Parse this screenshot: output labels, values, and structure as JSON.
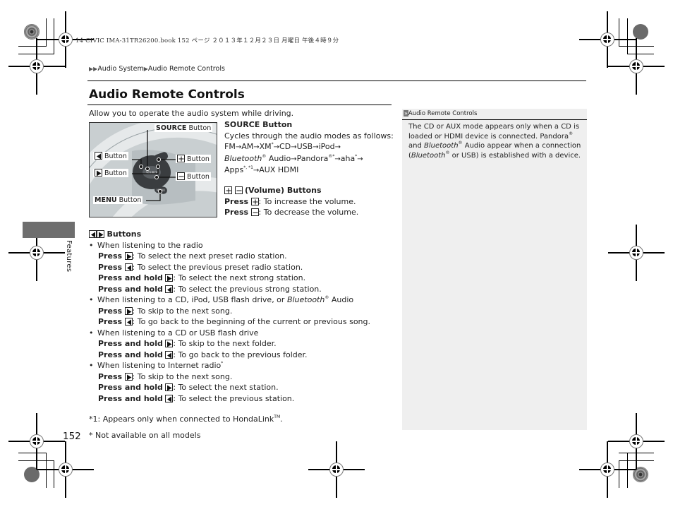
{
  "print_header": "14 CIVIC IMA-31TR26200.book  152 ページ  ２０１３年１２月２３日  月曜日  午後４時９分",
  "breadcrumb": {
    "prefix_icon": "double-triangle-icon",
    "items": [
      "Audio System",
      "Audio Remote Controls"
    ]
  },
  "page_title": "Audio Remote Controls",
  "intro": "Allow you to operate the audio system while driving.",
  "figure": {
    "labels": {
      "source": {
        "bold": "SOURCE",
        "rest": " Button"
      },
      "prev": "Button",
      "next": "Button",
      "plus": "Button",
      "minus": "Button",
      "menu": {
        "bold": "MENU",
        "rest": " Button"
      }
    },
    "wheel_text": {
      "source": "SOURCE",
      "menu": "MENU"
    }
  },
  "source_section": {
    "heading": "SOURCE Button",
    "desc": "Cycles through the audio modes as follows:",
    "modes": [
      "FM",
      "AM",
      "XM",
      "CD",
      "USB",
      "iPod",
      "Bluetooth",
      "Audio",
      "Pandora",
      "aha",
      "Apps",
      "AUX HDMI"
    ],
    "note_marks": {
      "star": "*",
      "star1": "*1",
      "reg": "®"
    }
  },
  "volume_section": {
    "heading": "(Volume) Buttons",
    "press": "Press",
    "increase": ": To increase the volume.",
    "decrease": ": To decrease the volume."
  },
  "sidebar_note": {
    "heading": "Audio Remote Controls",
    "body_1": "The CD or AUX mode appears only when a CD is loaded or HDMI device is connected. Pandora",
    "body_2": " and ",
    "body_bt": "Bluetooth",
    "body_3": " Audio appear when a connection (",
    "body_4": " or USB) is established with a device."
  },
  "buttons_section": {
    "heading": "Buttons",
    "groups": [
      {
        "condition": "When listening to the radio",
        "items": [
          {
            "action": "Press",
            "dir": "next",
            "text": ": To select the next preset radio station."
          },
          {
            "action": "Press",
            "dir": "prev",
            "text": ": To select the previous preset radio station."
          },
          {
            "action": "Press and hold",
            "dir": "next",
            "text": ": To select the next strong station."
          },
          {
            "action": "Press and hold",
            "dir": "prev",
            "text": ": To select the previous strong station."
          }
        ]
      },
      {
        "condition_a": "When listening to a CD, iPod, USB flash drive, or ",
        "condition_b": "Bluetooth",
        "condition_c": " Audio",
        "items": [
          {
            "action": "Press",
            "dir": "next",
            "text": ": To skip to the next song."
          },
          {
            "action": "Press",
            "dir": "prev",
            "text": ": To go back to the beginning of the current or previous song."
          }
        ]
      },
      {
        "condition": "When listening to a CD or USB flash drive",
        "items": [
          {
            "action": "Press and hold",
            "dir": "next",
            "text": ": To skip to the next folder."
          },
          {
            "action": "Press and hold",
            "dir": "prev",
            "text": ": To go back to the previous folder."
          }
        ]
      },
      {
        "condition": "When listening to Internet radio",
        "items": [
          {
            "action": "Press",
            "dir": "next",
            "text": ": To skip to the next song."
          },
          {
            "action": "Press and hold",
            "dir": "next",
            "text": ": To select the next station."
          },
          {
            "action": "Press and hold",
            "dir": "prev",
            "text": ": To select the previous station."
          }
        ]
      }
    ]
  },
  "footnote": "*1: Appears only when connected to HondaLink",
  "footnote_tm": "TM",
  "page_number": "152",
  "availability_note": "* Not available on all models",
  "section_tab": "Features"
}
